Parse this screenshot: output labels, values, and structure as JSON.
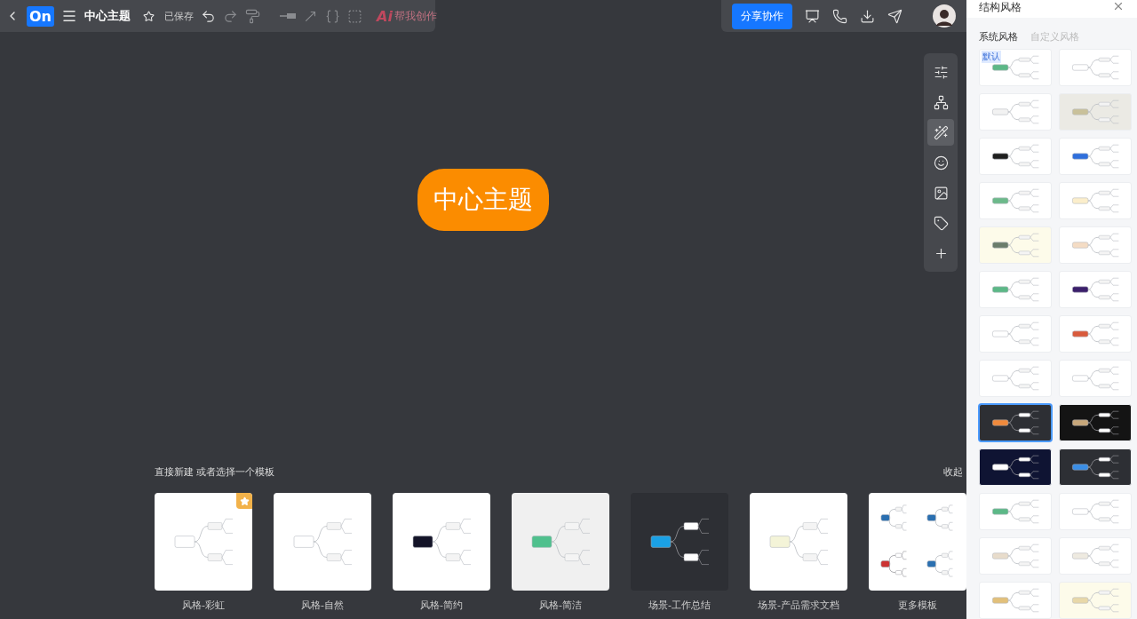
{
  "toolbar": {
    "logo": "On",
    "title": "中心主题",
    "save_status": "已保存",
    "ai_label": "Ai",
    "ai_text": "帮我创作",
    "share_button": "分享协作"
  },
  "side_tools": [
    {
      "kind": "sliders",
      "selected": false
    },
    {
      "kind": "structure",
      "selected": false
    },
    {
      "kind": "wand",
      "selected": true
    },
    {
      "kind": "emoji",
      "selected": false
    },
    {
      "kind": "image",
      "selected": false
    },
    {
      "kind": "tag",
      "selected": false
    },
    {
      "kind": "add",
      "selected": false
    }
  ],
  "central_topic": "中心主题",
  "templates": {
    "heading": "直接新建 或者选择一个模板",
    "collapse": "收起",
    "items": [
      {
        "label": "风格-彩虹",
        "kind": "light",
        "featured": true
      },
      {
        "label": "风格-自然",
        "kind": "light",
        "featured": false
      },
      {
        "label": "风格-简约",
        "kind": "bold",
        "featured": false
      },
      {
        "label": "风格-简洁",
        "kind": "grey",
        "featured": false
      },
      {
        "label": "场景-工作总结",
        "kind": "dark",
        "featured": false
      },
      {
        "label": "场景-产品需求文档",
        "kind": "soft",
        "featured": false
      },
      {
        "label": "更多模板",
        "kind": "more",
        "featured": false
      }
    ]
  },
  "panel": {
    "title": "结构风格",
    "tabs": [
      {
        "label": "系统风格",
        "selected": true
      },
      {
        "label": "自定义风格",
        "selected": false
      }
    ],
    "styles": [
      {
        "kind": "light",
        "color": "#5cb887",
        "badge": "默认",
        "selected": false
      },
      {
        "kind": "light",
        "color": "#ffffff",
        "selected": false
      },
      {
        "kind": "light",
        "color": "#f2f2f2",
        "selected": false
      },
      {
        "kind": "beige",
        "color": "#c9c19a",
        "selected": false
      },
      {
        "kind": "light",
        "color": "#1f1f1f",
        "selected": false
      },
      {
        "kind": "light",
        "color": "#2f6fdc",
        "selected": false
      },
      {
        "kind": "light",
        "color": "#6cb98a",
        "selected": false
      },
      {
        "kind": "light",
        "color": "#fbeecb",
        "selected": false
      },
      {
        "kind": "cream",
        "color": "#6b7d6c",
        "selected": false
      },
      {
        "kind": "light",
        "color": "#f4dcc4",
        "selected": false
      },
      {
        "kind": "light",
        "color": "#5cb887",
        "selected": false
      },
      {
        "kind": "light",
        "color": "#3b1f6b",
        "selected": false
      },
      {
        "kind": "light",
        "color": "#ffffff",
        "selected": false
      },
      {
        "kind": "light",
        "color": "#d95a3c",
        "selected": false
      },
      {
        "kind": "light",
        "color": "#ffffff",
        "selected": false
      },
      {
        "kind": "light",
        "color": "#ffffff",
        "selected": false
      },
      {
        "kind": "dark",
        "color": "#f08a3c",
        "selected": true
      },
      {
        "kind": "black",
        "color": "#c8a77a",
        "selected": false
      },
      {
        "kind": "navy",
        "color": "#ffffff",
        "selected": false
      },
      {
        "kind": "dark",
        "color": "#3a8ee6",
        "selected": false
      },
      {
        "kind": "light",
        "color": "#5cb887",
        "selected": false
      },
      {
        "kind": "light",
        "color": "#ffffff",
        "selected": false
      },
      {
        "kind": "light",
        "color": "#e8dccb",
        "selected": false
      },
      {
        "kind": "light",
        "color": "#eeeae0",
        "selected": false
      },
      {
        "kind": "light",
        "color": "#e2c07a",
        "selected": false
      },
      {
        "kind": "cream",
        "color": "#e8d8a8",
        "selected": false
      }
    ]
  }
}
